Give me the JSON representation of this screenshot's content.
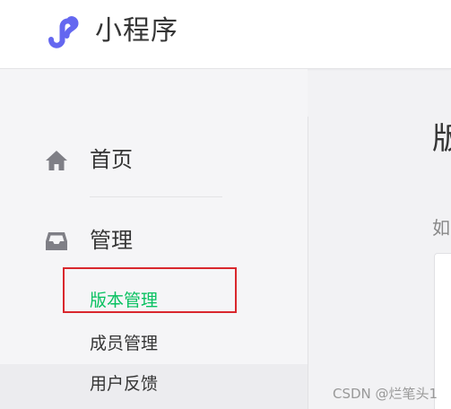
{
  "header": {
    "app_name": "小程序",
    "logo_icon": "mini-program-logo-icon",
    "brand_color": "#6467f0"
  },
  "sidebar": {
    "items": [
      {
        "label": "首页",
        "icon": "home-icon"
      },
      {
        "label": "管理",
        "icon": "inbox-icon"
      }
    ],
    "sub_items": [
      {
        "label": "版本管理",
        "state": "active"
      },
      {
        "label": "成员管理"
      },
      {
        "label": "用户反馈"
      }
    ],
    "active_color": "#07c160"
  },
  "main": {
    "title_partial": "版",
    "hint_partial": "如"
  },
  "watermark": "CSDN @烂笔头1"
}
